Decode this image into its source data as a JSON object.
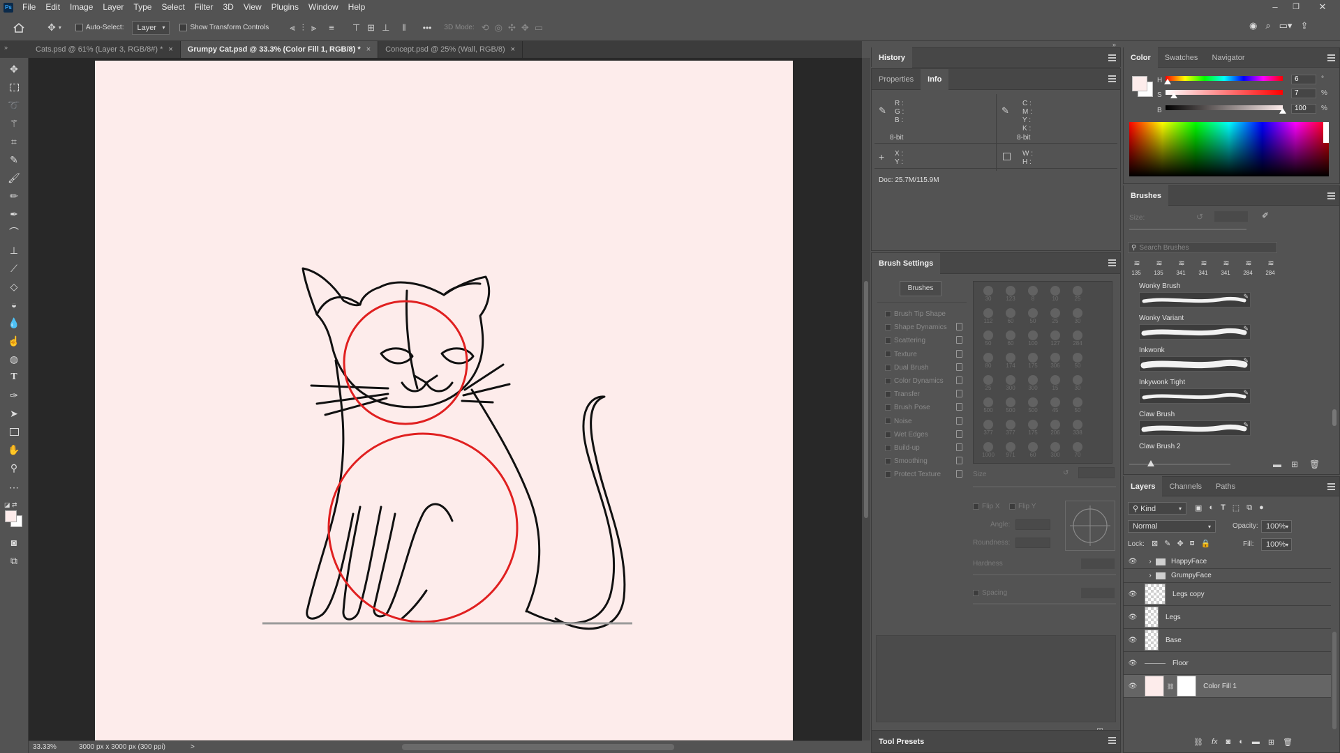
{
  "app": {
    "logo": "Ps"
  },
  "menu": [
    "File",
    "Edit",
    "Image",
    "Layer",
    "Type",
    "Select",
    "Filter",
    "3D",
    "View",
    "Plugins",
    "Window",
    "Help"
  ],
  "window_controls": {
    "minimize": "–",
    "restore": "❐",
    "close": "✕"
  },
  "options_bar": {
    "auto_select_label": "Auto-Select:",
    "auto_select_target": "Layer",
    "show_transform_label": "Show Transform Controls",
    "more": "•••",
    "mode_3d_label": "3D Mode:"
  },
  "tabs": [
    {
      "label": "Cats.psd @ 61% (Layer 3, RGB/8#) *",
      "close": "×",
      "active": false
    },
    {
      "label": "Grumpy Cat.psd @ 33.3% (Color Fill 1, RGB/8) *",
      "close": "×",
      "active": true
    },
    {
      "label": "Concept.psd @ 25% (Wall, RGB/8)",
      "close": "×",
      "active": false
    }
  ],
  "tools": [
    "move-tool",
    "marquee-tool",
    "lasso-tool",
    "magic-wand-tool",
    "crop-tool",
    "eyedropper-tool",
    "healing-brush-tool",
    "brush-tool",
    "clone-stamp-tool",
    "history-brush-tool",
    "eraser-tool",
    "paint-bucket-tool",
    "blur-tool",
    "dodge-tool",
    "pen-tool",
    "type-tool",
    "path-selection-tool",
    "shape-tool",
    "hand-tool",
    "zoom-tool",
    "more-tools"
  ],
  "status": {
    "zoom": "33.33%",
    "doc_size": "3000 px x 3000 px (300 ppi)",
    "arrow": ">"
  },
  "history_panel": {
    "tab": "History"
  },
  "info_panel": {
    "tabs": [
      "Properties",
      "Info"
    ],
    "rgb": [
      "R :",
      "G :",
      "B :"
    ],
    "cmyk": [
      "C :",
      "M :",
      "Y :",
      "K :"
    ],
    "bit_left": "8-bit",
    "bit_right": "8-bit",
    "xy": [
      "X :",
      "Y :"
    ],
    "wh": [
      "W :",
      "H :"
    ],
    "doc": "Doc: 25.7M/115.9M"
  },
  "brush_settings": {
    "tab": "Brush Settings",
    "brushes_button": "Brushes",
    "items": [
      "Brush Tip Shape",
      "Shape Dynamics",
      "Scattering",
      "Texture",
      "Dual Brush",
      "Color Dynamics",
      "Transfer",
      "Brush Pose",
      "Noise",
      "Wet Edges",
      "Build-up",
      "Smoothing",
      "Protect Texture"
    ],
    "tip_sizes": [
      "30",
      "123",
      "8",
      "10",
      "25",
      "112",
      "60",
      "50",
      "25",
      "30",
      "50",
      "60",
      "100",
      "127",
      "284",
      "80",
      "174",
      "175",
      "306",
      "50",
      "25",
      "300",
      "300",
      "15",
      "30",
      "500",
      "500",
      "500",
      "45",
      "50",
      "377",
      "377",
      "175",
      "206",
      "338",
      "1000",
      "971",
      "60",
      "300",
      "70"
    ],
    "size_label": "Size",
    "flip_x": "Flip X",
    "flip_y": "Flip Y",
    "angle_label": "Angle:",
    "roundness_label": "Roundness:",
    "hardness_label": "Hardness",
    "spacing_label": "Spacing"
  },
  "tool_presets": {
    "tab": "Tool Presets"
  },
  "color_panel": {
    "tabs": [
      "Color",
      "Swatches",
      "Navigator"
    ],
    "h_label": "H",
    "h_value": "6",
    "h_unit": "°",
    "s_label": "S",
    "s_value": "7",
    "s_unit": "%",
    "b_label": "B",
    "b_value": "100",
    "b_unit": "%",
    "h_fraction": 0.017,
    "s_fraction": 0.07,
    "b_fraction": 1.0
  },
  "brushes_panel": {
    "tab": "Brushes",
    "size_label": "Size:",
    "search_placeholder": "Search Brushes",
    "presets": [
      "135",
      "135",
      "341",
      "341",
      "341",
      "284",
      "284"
    ],
    "list": [
      "Wonky Brush",
      "Wonky Variant",
      "Inkwonk",
      "Inkywonk Tight",
      "Claw Brush",
      "Claw Brush 2"
    ]
  },
  "layers_panel": {
    "tabs": [
      "Layers",
      "Channels",
      "Paths"
    ],
    "kind": "Kind",
    "blend_mode": "Normal",
    "opacity_label": "Opacity:",
    "opacity": "100%",
    "lock_label": "Lock:",
    "fill_label": "Fill:",
    "fill": "100%",
    "layers": [
      {
        "name": "HappyFace",
        "type": "group",
        "visible": true
      },
      {
        "name": "GrumpyFace",
        "type": "group",
        "visible": false
      },
      {
        "name": "Legs copy",
        "type": "pixel",
        "visible": true
      },
      {
        "name": "Legs",
        "type": "pixel",
        "visible": true
      },
      {
        "name": "Base",
        "type": "pixel",
        "visible": true
      },
      {
        "name": "Floor",
        "type": "line",
        "visible": true
      },
      {
        "name": "Color Fill 1",
        "type": "fill",
        "visible": true,
        "selected": true
      }
    ]
  },
  "colors": {
    "accent_red": "#e02020",
    "canvas_bg": "#fdeceb",
    "selected_layer": "#656565"
  }
}
